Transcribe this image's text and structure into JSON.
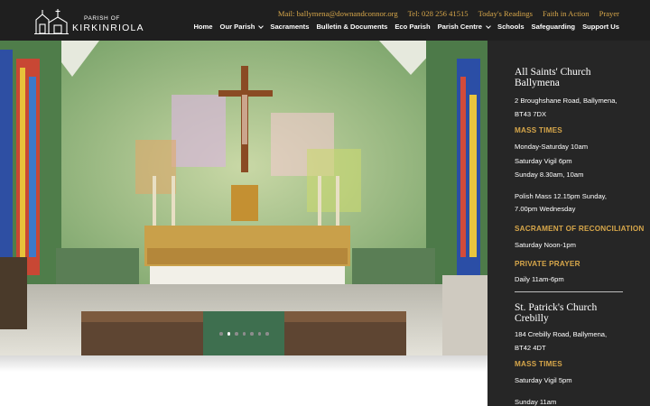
{
  "header": {
    "logo": {
      "small_text": "PARISH OF",
      "big_text": "KIRKINRIOLA"
    },
    "top_links": [
      "Mail: ballymena@downandconnor.org",
      "Tel: 028 256 41515",
      "Today's Readings",
      "Faith in Action",
      "Prayer"
    ],
    "nav": [
      {
        "label": "Home",
        "has_dropdown": false
      },
      {
        "label": "Our Parish",
        "has_dropdown": true
      },
      {
        "label": "Sacraments",
        "has_dropdown": false
      },
      {
        "label": "Bulletin & Documents",
        "has_dropdown": false
      },
      {
        "label": "Eco Parish",
        "has_dropdown": false
      },
      {
        "label": "Parish Centre",
        "has_dropdown": true
      },
      {
        "label": "Schools",
        "has_dropdown": false
      },
      {
        "label": "Safeguarding",
        "has_dropdown": false
      },
      {
        "label": "Support Us",
        "has_dropdown": false
      }
    ]
  },
  "slider": {
    "slide_count": 7,
    "active_index": 1
  },
  "sidebar": {
    "church1": {
      "name_line1": "All Saints' Church",
      "name_line2": "Ballymena",
      "address_line1": "2 Broughshane Road, Ballymena,",
      "address_line2": "BT43 7DX",
      "mass_heading": "MASS TIMES",
      "mass_times": [
        "Monday-Saturday 10am",
        "Saturday Vigil 6pm",
        "Sunday 8.30am, 10am"
      ],
      "polish_line1": "Polish Mass 12.15pm Sunday,",
      "polish_line2": "7.00pm Wednesday",
      "reconciliation_heading": "SACRAMENT OF RECONCILIATION",
      "reconciliation_time": "Saturday Noon-1pm",
      "prayer_heading": "PRIVATE PRAYER",
      "prayer_time": "Daily 11am-6pm"
    },
    "church2": {
      "name_line1": "St. Patrick's Church",
      "name_line2": "Crebilly",
      "address_line1": "184 Crebilly Road, Ballymena,",
      "address_line2": "BT42 4DT",
      "mass_heading": "MASS TIMES",
      "mass_times": [
        "Saturday Vigil 5pm",
        "Sunday 11am"
      ]
    }
  },
  "colors": {
    "header_bg": "#1f1f1f",
    "sidebar_bg": "#262626",
    "accent_gold": "#d6a64a"
  }
}
